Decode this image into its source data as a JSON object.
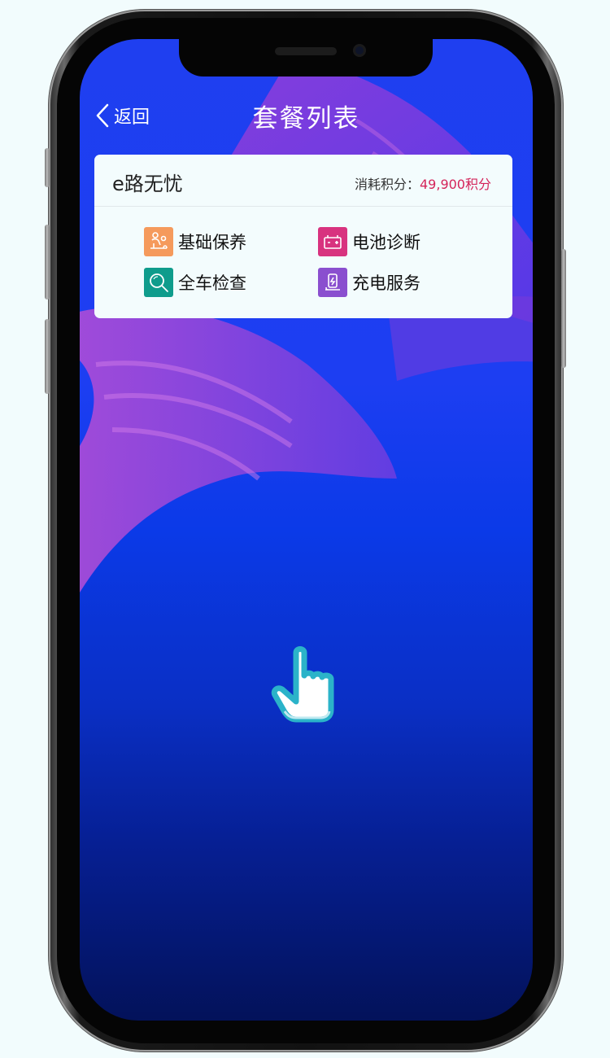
{
  "nav": {
    "back_label": "返回",
    "title": "套餐列表"
  },
  "package": {
    "name": "e路无忧",
    "points_label": "消耗积分：",
    "points_value": "49,900积分",
    "services": [
      {
        "label": "基础保养",
        "icon": "maintenance-icon",
        "color": "#f59a5c"
      },
      {
        "label": "电池诊断",
        "icon": "battery-icon",
        "color": "#d8337f"
      },
      {
        "label": "全车检查",
        "icon": "magnifier-icon",
        "color": "#0f9c8c"
      },
      {
        "label": "充电服务",
        "icon": "charging-icon",
        "color": "#8a4fcf"
      }
    ]
  },
  "colors": {
    "accent_points": "#d4245a",
    "screen_top": "#1f3ff0",
    "screen_bottom": "#03125a"
  }
}
